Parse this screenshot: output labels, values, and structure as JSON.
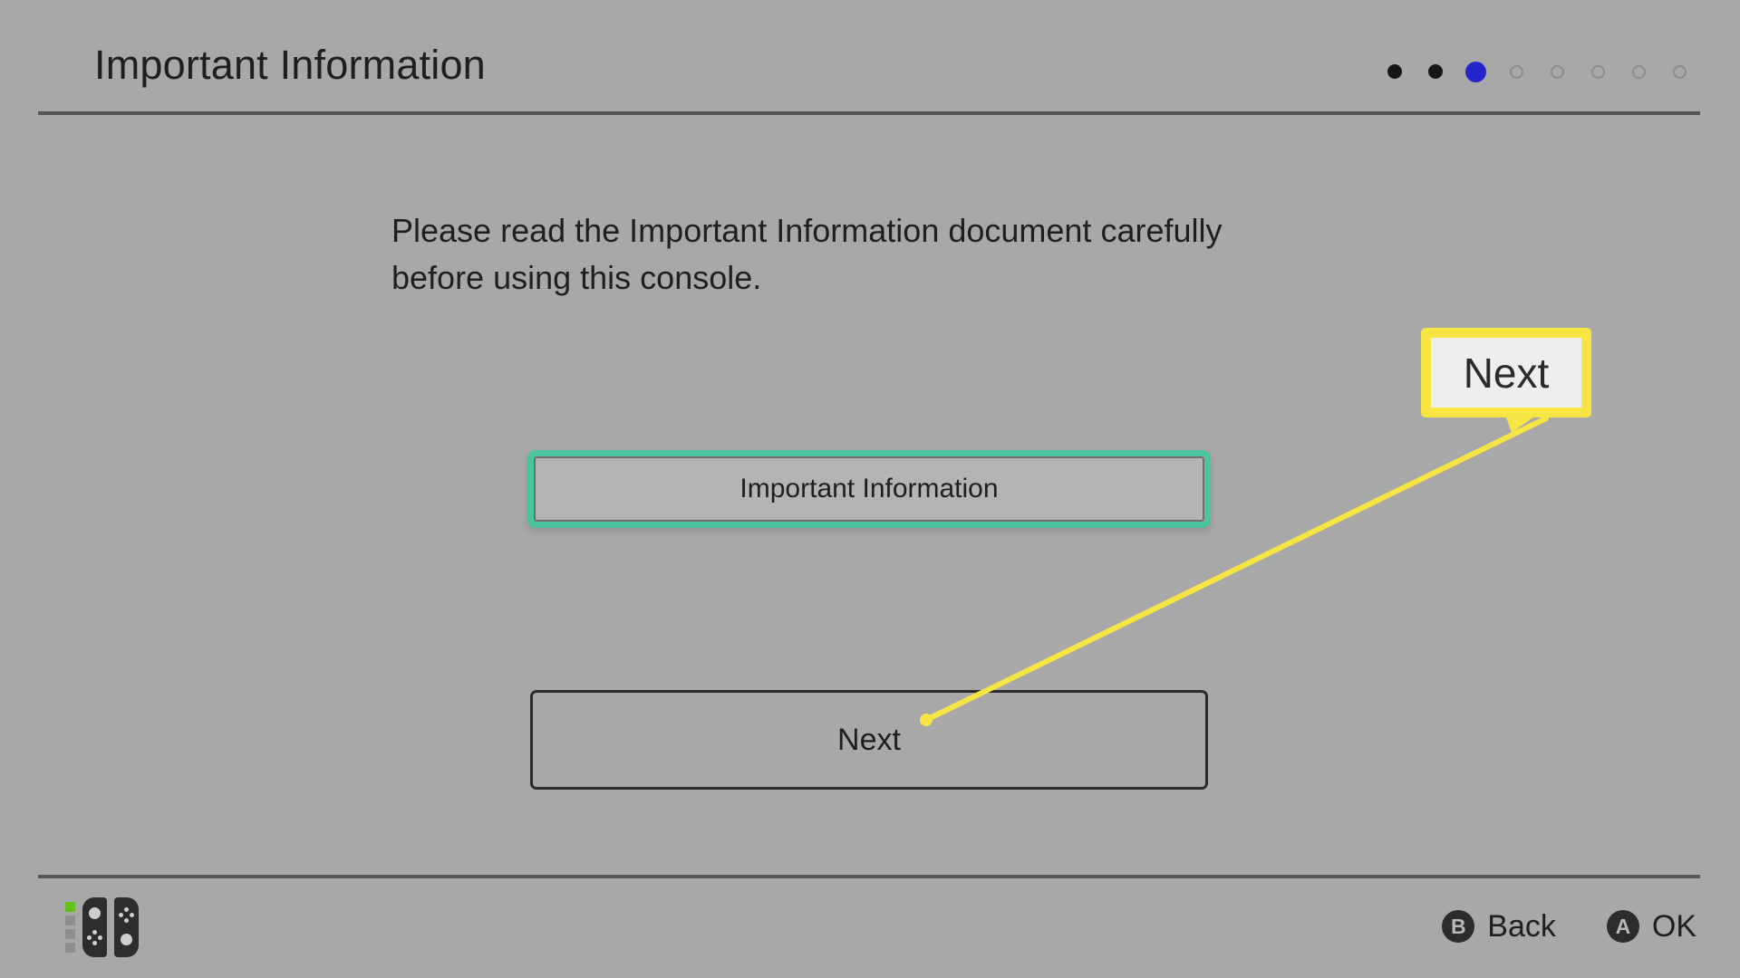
{
  "header": {
    "title": "Important Information",
    "pagination": {
      "total": 8,
      "current_index": 3,
      "states": [
        "done",
        "done",
        "current",
        "todo",
        "todo",
        "todo",
        "todo",
        "todo"
      ],
      "colors": {
        "done": "#161616",
        "current": "#2424cb",
        "todo_border": "#8d8d8d"
      }
    }
  },
  "main": {
    "instruction_line_1": "Please read the Important Information document carefully",
    "instruction_line_2": "before using this console.",
    "option_button": {
      "label": "Important Information",
      "focused": true,
      "focus_color": "#4cc4a0"
    },
    "next_button": {
      "label": "Next"
    }
  },
  "annotation": {
    "callout_label": "Next",
    "border_color": "#f7e544",
    "fill_color": "#eeeeee",
    "line_color": "#f7e544"
  },
  "bottom_bar": {
    "controller": {
      "icon_name": "joy-con-pair-icon",
      "player_leds": [
        "on",
        "off",
        "off",
        "off"
      ],
      "led_on_color": "#62c21b",
      "led_off_color": "#8f8f8f"
    },
    "actions": [
      {
        "badge": "B",
        "label": "Back"
      },
      {
        "badge": "A",
        "label": "OK"
      }
    ]
  },
  "theme": {
    "background": "#a8a8a8",
    "divider": "#555555",
    "text": "#1e1e1e",
    "button_fill": "#b4b4b4"
  }
}
